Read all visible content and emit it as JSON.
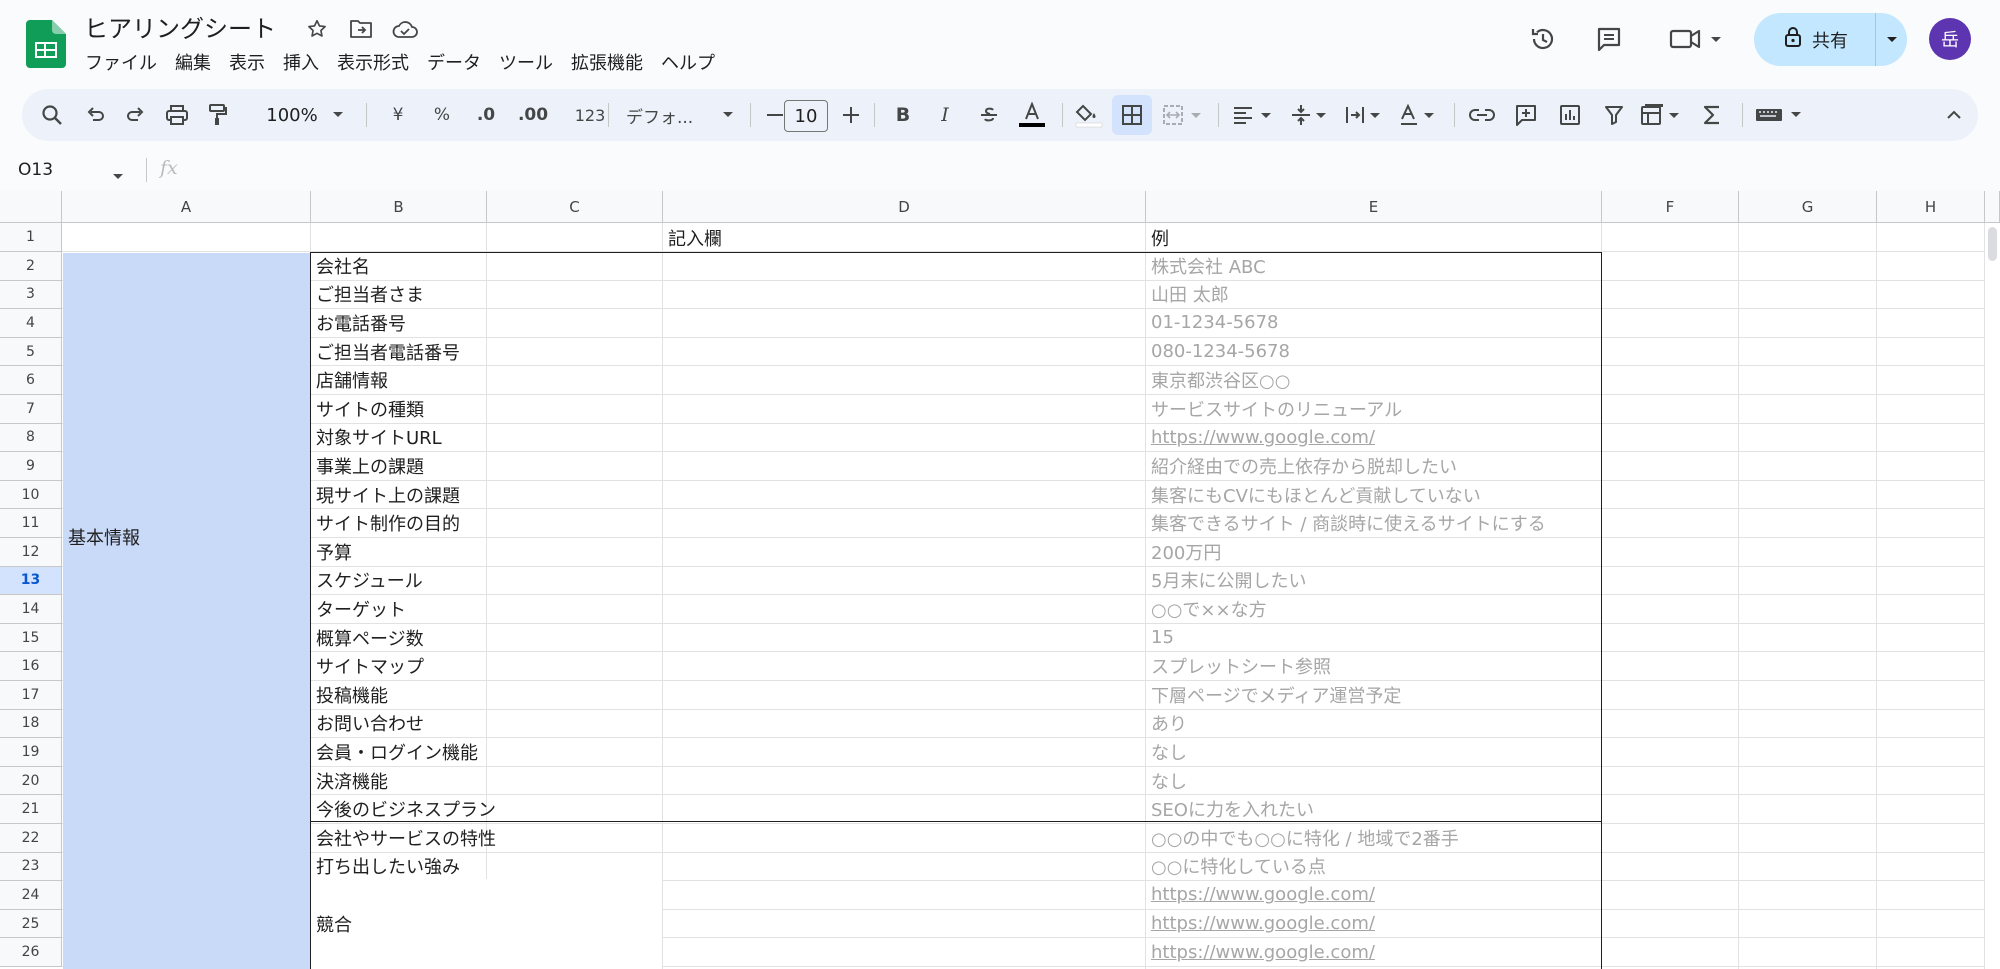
{
  "app": {
    "title": "ヒアリングシート",
    "menu": [
      "ファイル",
      "編集",
      "表示",
      "挿入",
      "表示形式",
      "データ",
      "ツール",
      "拡張機能",
      "ヘルプ"
    ],
    "share_label": "共有",
    "avatar_letter": "岳",
    "accent_color": "#0f9d58"
  },
  "toolbar": {
    "zoom": "100%",
    "currency": "¥",
    "percent": "%",
    "dec_decrease": ".0",
    "dec_increase": ".00",
    "number_format": "123",
    "font": "デフォ...",
    "font_size": "10",
    "bold": "B",
    "italic": "I"
  },
  "formula_bar": {
    "name_box": "O13",
    "fx": "fx"
  },
  "columns": [
    "A",
    "B",
    "C",
    "D",
    "E",
    "F",
    "G",
    "H"
  ],
  "rows": [
    "1",
    "2",
    "3",
    "4",
    "5",
    "6",
    "7",
    "8",
    "9",
    "10",
    "11",
    "12",
    "13",
    "14",
    "15",
    "16",
    "17",
    "18",
    "19",
    "20",
    "21",
    "22",
    "23",
    "24",
    "25",
    "26"
  ],
  "selected_row": "13",
  "sheet": {
    "d1": "記入欄",
    "e1": "例",
    "section_a": "基本情報",
    "labels": [
      "会社名",
      "ご担当者さま",
      "お電話番号",
      "ご担当者電話番号",
      "店舗情報",
      "サイトの種類",
      "対象サイトURL",
      "事業上の課題",
      "現サイト上の課題",
      "サイト制作の目的",
      "予算",
      "スケジュール",
      "ターゲット",
      "概算ページ数",
      "サイトマップ",
      "投稿機能",
      "お問い合わせ",
      "会員・ログイン機能",
      "決済機能",
      "今後のビジネスプラン",
      "会社やサービスの特性",
      "打ち出したい強み"
    ],
    "examples": [
      "株式会社 ABC",
      "山田 太郎",
      "01-1234-5678",
      "080-1234-5678",
      "東京都渋谷区○○",
      "サービスサイトのリニューアル",
      "https://www.google.com/",
      "紹介経由での売上依存から脱却したい",
      "集客にもCVにもほとんど貢献していない",
      "集客できるサイト / 商談時に使えるサイトにする",
      "200万円",
      "5月末に公開したい",
      "○○で××な方",
      "15",
      "スプレットシート参照",
      "下層ページでメディア運営予定",
      "あり",
      "なし",
      "なし",
      "SEOに力を入れたい",
      "○○の中でも○○に特化 / 地域で2番手",
      "○○に特化している点"
    ],
    "competitor_label": "競合",
    "competitor_examples": [
      "https://www.google.com/",
      "https://www.google.com/",
      "https://www.google.com/"
    ]
  }
}
